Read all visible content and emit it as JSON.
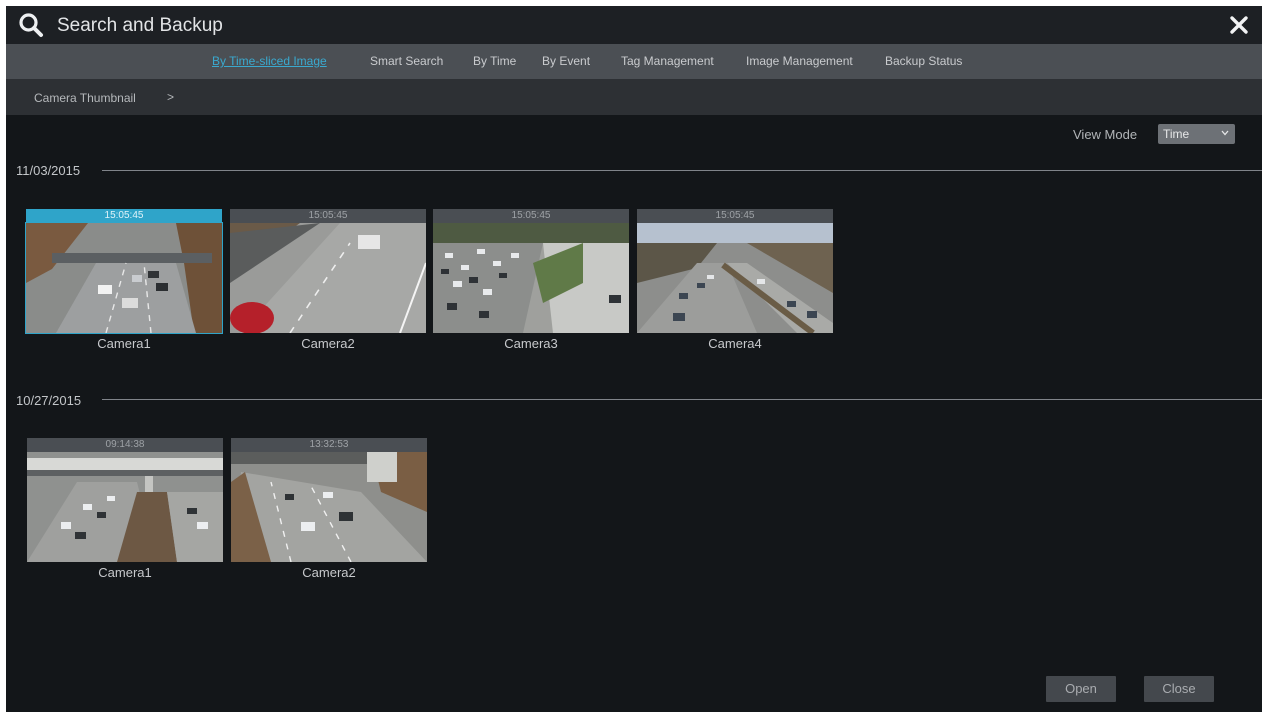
{
  "window": {
    "title": "Search and Backup",
    "title_icon": "search-icon",
    "close_icon": "close-icon"
  },
  "tabs": [
    {
      "label": "By Time-sliced Image",
      "active": true
    },
    {
      "label": "Smart Search",
      "active": false
    },
    {
      "label": "By Time",
      "active": false
    },
    {
      "label": "By Event",
      "active": false
    },
    {
      "label": "Tag Management",
      "active": false
    },
    {
      "label": "Image Management",
      "active": false
    },
    {
      "label": "Backup Status",
      "active": false
    }
  ],
  "breadcrumb": {
    "label": "Camera Thumbnail",
    "chevron": ">"
  },
  "view_mode": {
    "label": "View Mode",
    "value": "Time"
  },
  "groups": [
    {
      "date": "11/03/2015",
      "thumbnails": [
        {
          "camera": "Camera1",
          "time": "15:05:45",
          "selected": true
        },
        {
          "camera": "Camera2",
          "time": "15:05:45",
          "selected": false
        },
        {
          "camera": "Camera3",
          "time": "15:05:45",
          "selected": false
        },
        {
          "camera": "Camera4",
          "time": "15:05:45",
          "selected": false
        }
      ]
    },
    {
      "date": "10/27/2015",
      "thumbnails": [
        {
          "camera": "Camera1",
          "time": "09:14:38",
          "selected": false
        },
        {
          "camera": "Camera2",
          "time": "13:32:53",
          "selected": false
        }
      ]
    }
  ],
  "footer": {
    "open_label": "Open",
    "close_label": "Close"
  },
  "colors": {
    "accent": "#2fa4c9",
    "window_bg": "#131619",
    "tab_bar": "#4b4f54",
    "title_bar": "#1d2024"
  }
}
